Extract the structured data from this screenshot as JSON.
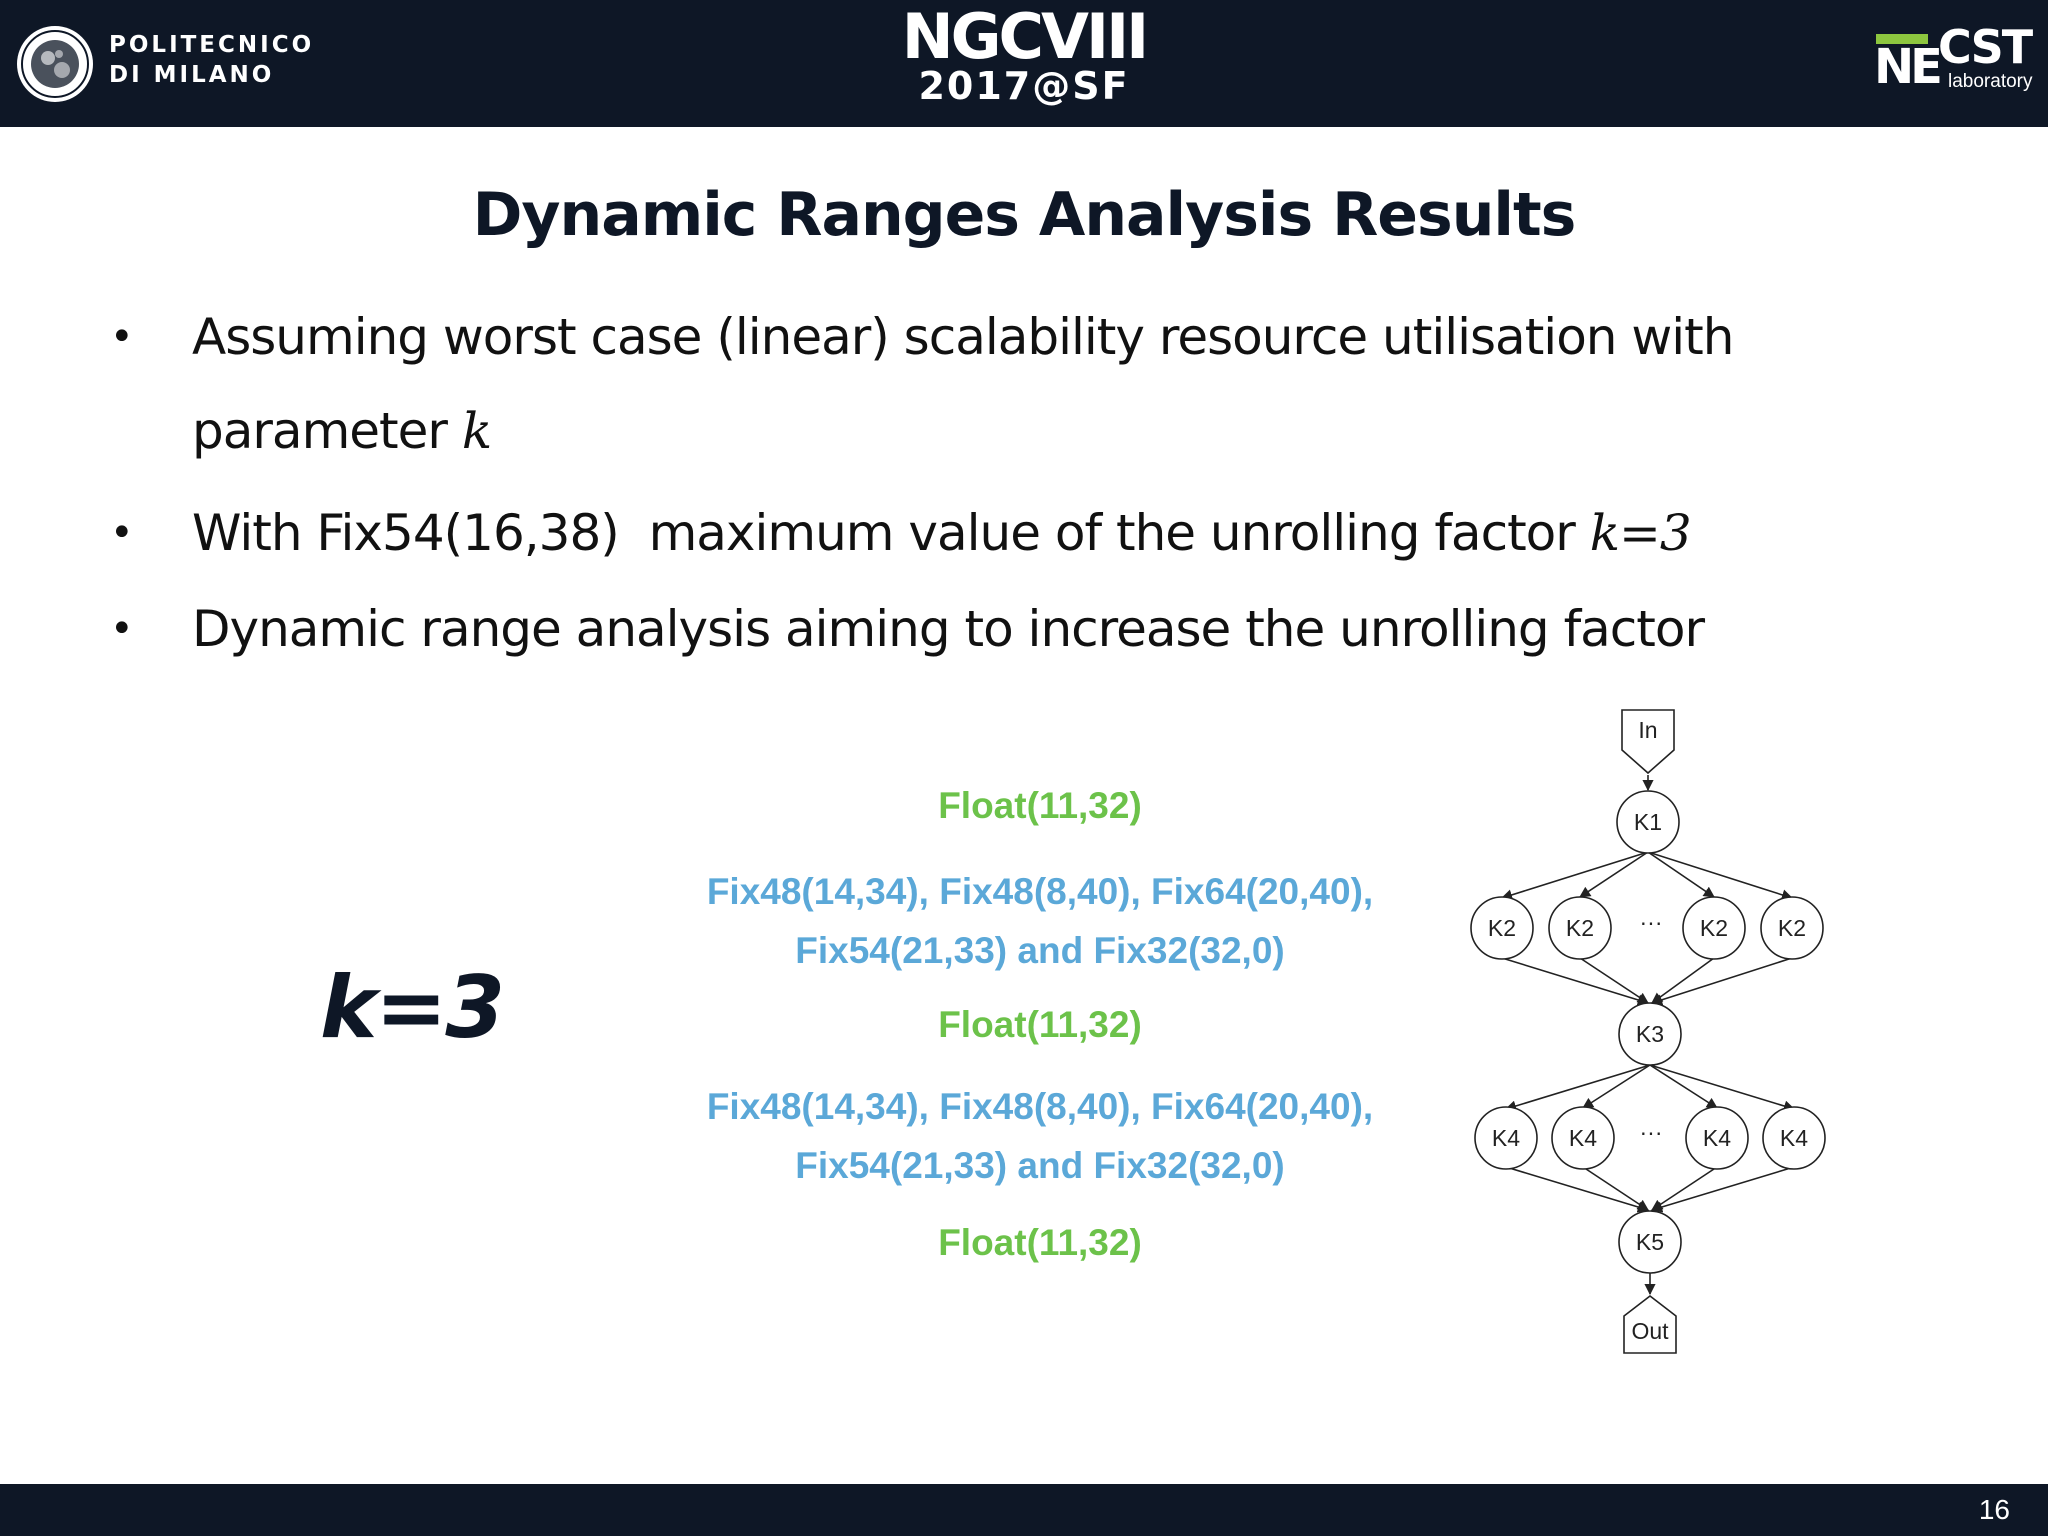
{
  "header": {
    "university_lines": [
      "POLITECNICO",
      "DI MILANO"
    ],
    "conference_title": "NGCVIII",
    "conference_subtitle": "2017@SF",
    "lab_logo": {
      "ne": "NE",
      "cst": "CST",
      "sub": "laboratory"
    },
    "colors": {
      "background": "#0e1726",
      "lab_accent": "#8dc63f"
    }
  },
  "slide": {
    "title": "Dynamic Ranges Analysis Results",
    "bullets": [
      {
        "text": "Assuming worst case (linear) scalability resource utilisation with",
        "text_line2": "parameter ",
        "math": "k"
      },
      {
        "text": "With Fix54(16,38)  maximum value of the unrolling factor ",
        "math": "k=3"
      },
      {
        "text": "Dynamic range analysis aiming to increase the unrolling factor"
      }
    ],
    "k_label": "k=3",
    "annotations": [
      {
        "text": "Float(11,32)",
        "color": "green"
      },
      {
        "line1": "Fix48(14,34), Fix48(8,40), Fix64(20,40),",
        "line2": "Fix54(21,33) and Fix32(32,0)",
        "color": "blue"
      },
      {
        "text": "Float(11,32)",
        "color": "green"
      },
      {
        "line1": "Fix48(14,34), Fix48(8,40), Fix64(20,40),",
        "line2": "Fix54(21,33) and Fix32(32,0)",
        "color": "blue"
      },
      {
        "text": "Float(11,32)",
        "color": "green"
      }
    ],
    "annotation_colors": {
      "green": "#6cc24a",
      "blue": "#5ba8d8"
    },
    "page_number": "16"
  },
  "graph": {
    "input": "In",
    "output": "Out",
    "ellipsis": "···",
    "nodes": {
      "k1": "K1",
      "k2": [
        "K2",
        "K2",
        "K2",
        "K2"
      ],
      "k3": "K3",
      "k4": [
        "K4",
        "K4",
        "K4",
        "K4"
      ],
      "k5": "K5"
    }
  }
}
